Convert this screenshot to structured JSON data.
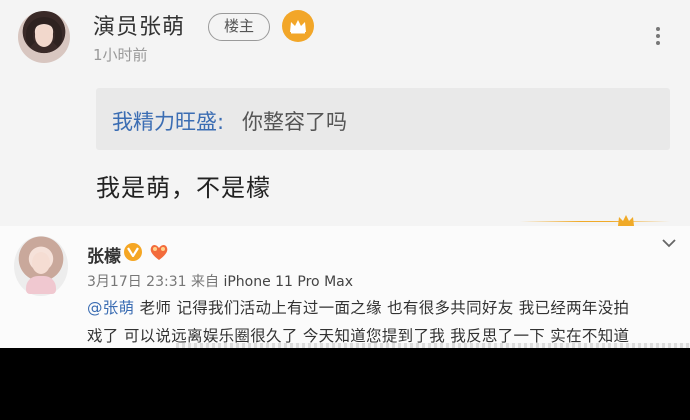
{
  "top_comment": {
    "author": "演员张萌",
    "op_badge": "楼主",
    "time": "1小时前",
    "quote_user": "我精力旺盛:",
    "quote_text": "你整容了吗",
    "reply": "我是萌，不是檬"
  },
  "second_comment": {
    "author": "张檬",
    "timestamp": "3月17日 23:31",
    "source_prefix": "来自",
    "device": "iPhone 11 Pro Max",
    "mention": "@张萌",
    "line1_rest": " 老师  记得我们活动上有过一面之缘  也有很多共同好友   我已经两年没拍",
    "line2": "戏了  可以说远离娱乐圈很久了  今天知道您提到了我  我反思了一下  实在不知道"
  },
  "icons": {
    "vip": "crown-badge-icon",
    "verified": "verified-v-icon",
    "fan": "fan-badge-icon",
    "more": "more-vertical-icon",
    "collapse": "chevron-down-icon",
    "divider": "crown-divider-icon"
  },
  "colors": {
    "link": "#3b6db3",
    "gold": "#f2a628",
    "panel_bg": "#f4f4f4"
  }
}
